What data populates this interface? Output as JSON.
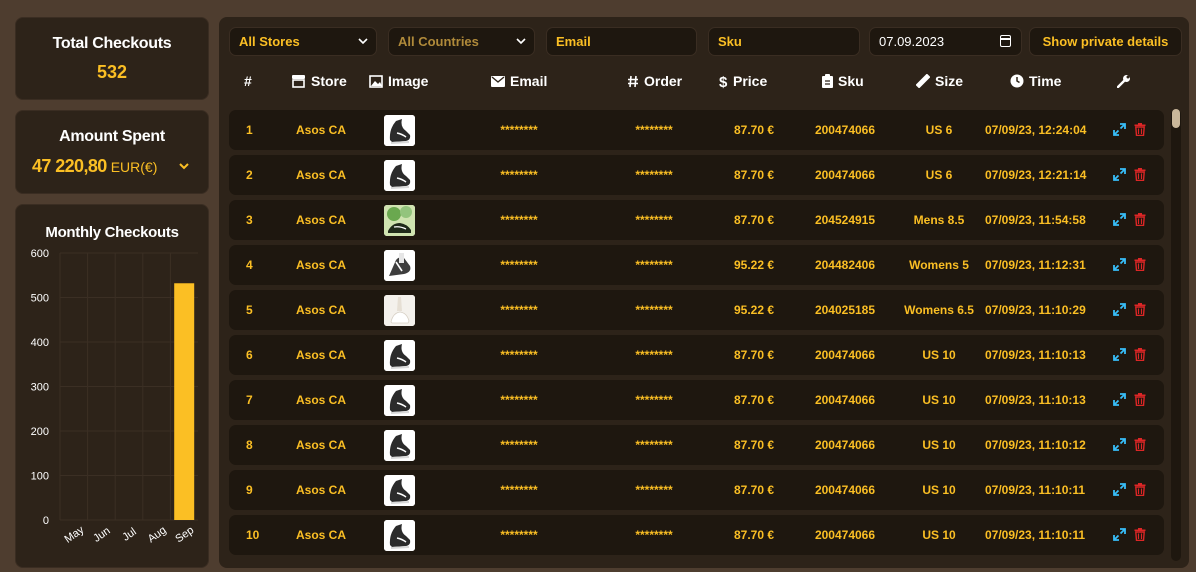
{
  "stats": {
    "total_checkouts_label": "Total Checkouts",
    "total_checkouts_value": "532",
    "amount_spent_label": "Amount Spent",
    "amount_spent_value": "47 220,80",
    "currency": "EUR(€)",
    "monthly_title": "Monthly Checkouts"
  },
  "chart_data": {
    "type": "bar",
    "title": "Monthly Checkouts",
    "categories": [
      "May",
      "Jun",
      "Jul",
      "Aug",
      "Sep"
    ],
    "values": [
      0,
      0,
      0,
      0,
      532
    ],
    "ylim": [
      0,
      600
    ],
    "yticks": [
      0,
      100,
      200,
      300,
      400,
      500,
      600
    ],
    "grid": true,
    "color": "#fbbf24"
  },
  "filters": {
    "store": "All Stores",
    "country": "All Countries",
    "email_placeholder": "Email",
    "sku_placeholder": "Sku",
    "date": "07.09.2023",
    "private_button": "Show private details"
  },
  "columns": {
    "num": "#",
    "store": "Store",
    "image": "Image",
    "email": "Email",
    "order": "Order",
    "price": "Price",
    "sku": "Sku",
    "size": "Size",
    "time": "Time"
  },
  "rows": [
    {
      "num": "1",
      "store": "Asos CA",
      "email": "********",
      "order": "********",
      "price": "87.70 €",
      "sku": "200474066",
      "size": "US 6",
      "time": "07/09/23, 12:24:04",
      "image": "sneaker-black-white"
    },
    {
      "num": "2",
      "store": "Asos CA",
      "email": "********",
      "order": "********",
      "price": "87.70 €",
      "sku": "200474066",
      "size": "US 6",
      "time": "07/09/23, 12:21:14",
      "image": "sneaker-black-white"
    },
    {
      "num": "3",
      "store": "Asos CA",
      "email": "********",
      "order": "********",
      "price": "87.70 €",
      "sku": "204524915",
      "size": "Mens 8.5",
      "time": "07/09/23, 11:54:58",
      "image": "sneaker-green-plants"
    },
    {
      "num": "4",
      "store": "Asos CA",
      "email": "********",
      "order": "********",
      "price": "95.22 €",
      "sku": "204482406",
      "size": "Womens 5",
      "time": "07/09/23, 11:12:31",
      "image": "sneaker-womens"
    },
    {
      "num": "5",
      "store": "Asos CA",
      "email": "********",
      "order": "********",
      "price": "95.22 €",
      "sku": "204025185",
      "size": "Womens 6.5",
      "time": "07/09/23, 11:10:29",
      "image": "sneaker-white"
    },
    {
      "num": "6",
      "store": "Asos CA",
      "email": "********",
      "order": "********",
      "price": "87.70 €",
      "sku": "200474066",
      "size": "US 10",
      "time": "07/09/23, 11:10:13",
      "image": "sneaker-black-white"
    },
    {
      "num": "7",
      "store": "Asos CA",
      "email": "********",
      "order": "********",
      "price": "87.70 €",
      "sku": "200474066",
      "size": "US 10",
      "time": "07/09/23, 11:10:13",
      "image": "sneaker-black-white"
    },
    {
      "num": "8",
      "store": "Asos CA",
      "email": "********",
      "order": "********",
      "price": "87.70 €",
      "sku": "200474066",
      "size": "US 10",
      "time": "07/09/23, 11:10:12",
      "image": "sneaker-black-white"
    },
    {
      "num": "9",
      "store": "Asos CA",
      "email": "********",
      "order": "********",
      "price": "87.70 €",
      "sku": "200474066",
      "size": "US 10",
      "time": "07/09/23, 11:10:11",
      "image": "sneaker-black-white"
    },
    {
      "num": "10",
      "store": "Asos CA",
      "email": "********",
      "order": "********",
      "price": "87.70 €",
      "sku": "200474066",
      "size": "US 10",
      "time": "07/09/23, 11:10:11",
      "image": "sneaker-black-white"
    }
  ],
  "colors": {
    "accent": "#fbbf24",
    "panel": "#2d2319",
    "row": "#1e170f",
    "expand_icon": "#38bdf8",
    "delete_icon": "#dc2626"
  }
}
